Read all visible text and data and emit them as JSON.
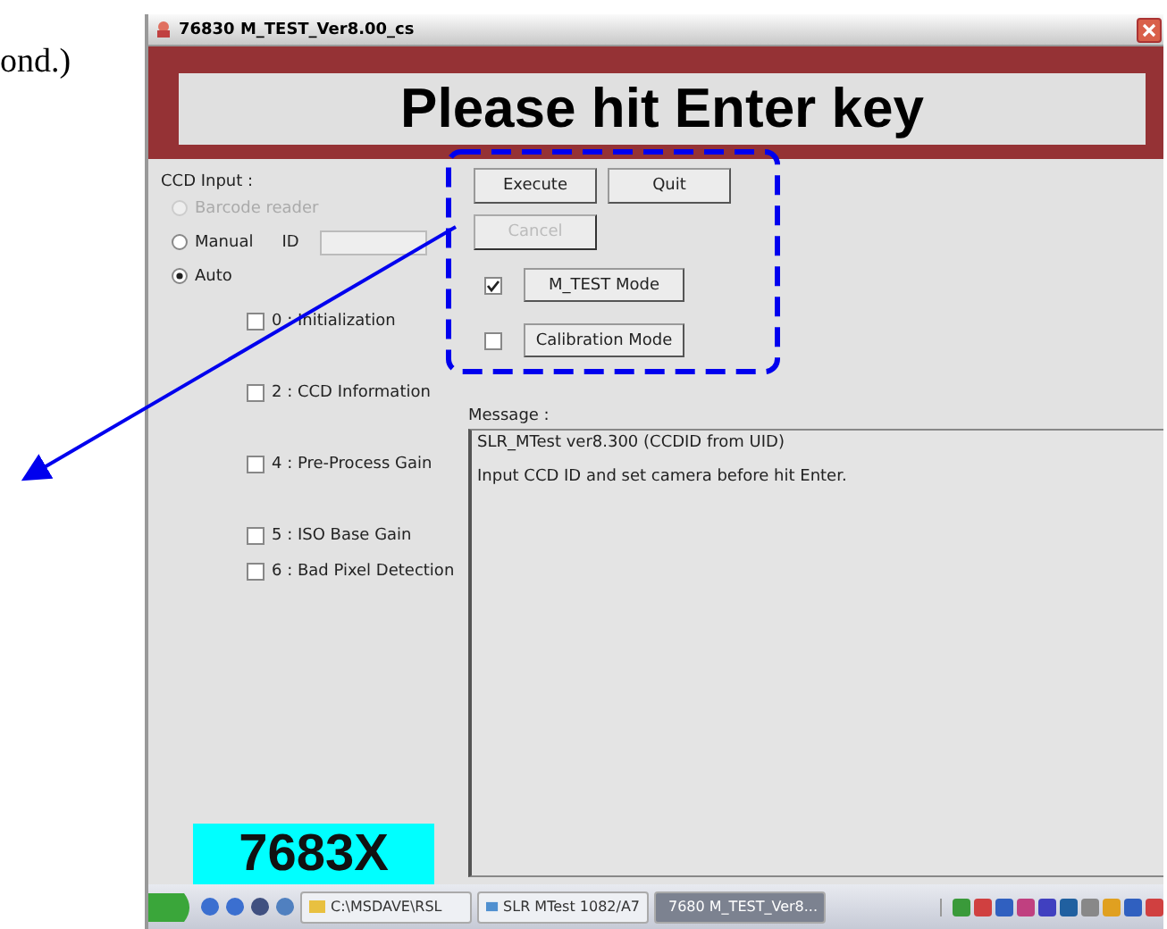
{
  "document_text": "ond.)",
  "window": {
    "title": "76830 M_TEST_Ver8.00_cs",
    "banner": "Please hit Enter key"
  },
  "ccd_input": {
    "label": "CCD Input :",
    "id_label": "ID",
    "options": [
      {
        "label": "Barcode reader",
        "selected": false,
        "disabled": true
      },
      {
        "label": "Manual",
        "selected": false,
        "disabled": false
      },
      {
        "label": "Auto",
        "selected": true,
        "disabled": false
      }
    ]
  },
  "buttons": [
    {
      "label": "Execute",
      "disabled": false
    },
    {
      "label": "Quit",
      "disabled": false
    },
    {
      "label": "Cancel",
      "disabled": true
    }
  ],
  "modes": [
    {
      "label": "M_TEST Mode",
      "checked": true
    },
    {
      "label": "Calibration Mode",
      "checked": false
    }
  ],
  "steps": [
    {
      "label": "0 : Initialization",
      "checked": false
    },
    {
      "label": "2 : CCD Information",
      "checked": false
    },
    {
      "label": "4 : Pre-Process Gain",
      "checked": false
    },
    {
      "label": "5 : ISO Base Gain",
      "checked": false
    },
    {
      "label": "6 : Bad Pixel Detection",
      "checked": false
    }
  ],
  "message": {
    "label": "Message :",
    "lines": [
      "SLR_MTest ver8.300 (CCDID from UID)",
      "Input CCD ID and set camera before hit Enter."
    ]
  },
  "model_badge": "7683X",
  "taskbar": {
    "tasks": [
      {
        "label": "C:\\MSDAVE\\RSL",
        "selected": false
      },
      {
        "label": "SLR MTest 1082/A7",
        "selected": false
      },
      {
        "label": "7680 M_TEST_Ver8...",
        "selected": true
      }
    ]
  }
}
